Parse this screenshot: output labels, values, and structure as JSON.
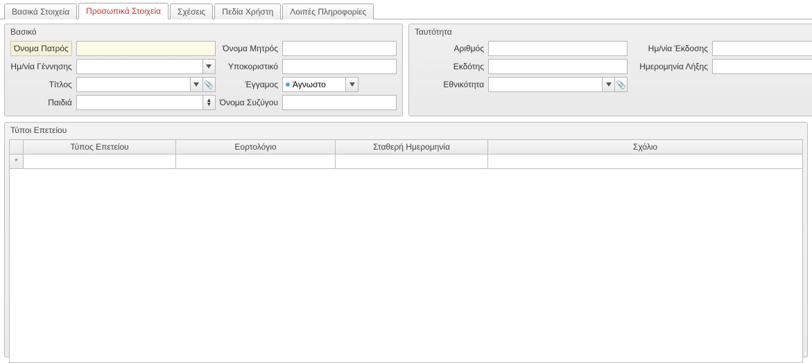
{
  "tabs": [
    {
      "label": "Βασικά Στοιχεία"
    },
    {
      "label": "Προσωπικά Στοιχεία"
    },
    {
      "label": "Σχέσεις"
    },
    {
      "label": "Πεδία Χρήστη"
    },
    {
      "label": "Λοιπές Πληροφορίες"
    }
  ],
  "basic": {
    "legend": "Βασικό",
    "father_name_label": "Όνομα Πατρός",
    "father_name_value": "",
    "mother_name_label": "Όνομα Μητρός",
    "mother_name_value": "",
    "birth_date_label": "Ημ/νία Γέννησης",
    "birth_date_value": "",
    "nickname_label": "Υποκοριστικό",
    "nickname_value": "",
    "title_label": "Τίτλος",
    "title_value": "",
    "marital_label": "Έγγαμος",
    "marital_value": "Άγνωστο",
    "children_label": "Παιδιά",
    "children_value": "",
    "spouse_label": "Όνομα Συζύγου",
    "spouse_value": ""
  },
  "identity": {
    "legend": "Ταυτότητα",
    "number_label": "Αριθμός",
    "number_value": "",
    "issue_date_label": "Ημ/νία Έκδοσης",
    "issue_date_value": "",
    "issuer_label": "Εκδότης",
    "issuer_value": "",
    "expiry_date_label": "Ημερομηνία Λήξης",
    "expiry_date_value": "",
    "nationality_label": "Εθνικότητα",
    "nationality_value": ""
  },
  "anniv": {
    "legend": "Τύποι Επετείου",
    "col_type": "Τύπος Επετείου",
    "col_calendar": "Εορτολόγιο",
    "col_fixed_date": "Σταθερή Ημερομηνία",
    "col_comment": "Σχόλιο",
    "newrow_marker": "*"
  }
}
